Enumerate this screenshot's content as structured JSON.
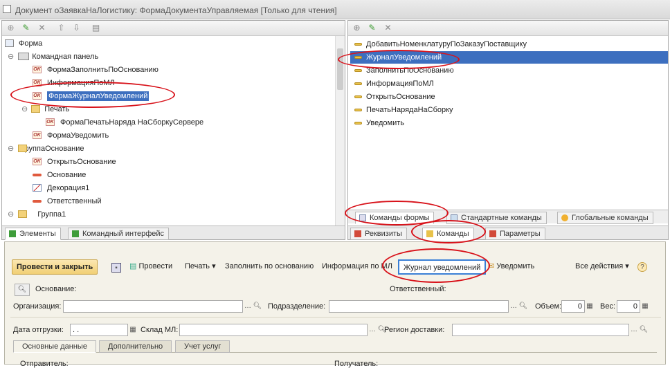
{
  "window": {
    "title": "Документ оЗаявкаНаЛогистику: ФормаДокументаУправляемая [Только для чтения]"
  },
  "left_tree": {
    "items": [
      {
        "label": "Форма"
      },
      {
        "label": "Командная панель"
      },
      {
        "label": "ФормаЗаполнитьПоОснованию"
      },
      {
        "label": "ИнформацияПоМЛ"
      },
      {
        "label": "ФормаЖурналУведомлений"
      },
      {
        "label": "Печать"
      },
      {
        "label": "ФормаПечатьНаряда НаСборкуСервере"
      },
      {
        "label": "ФормаУведомить"
      },
      {
        "label": "ГруппаОснование"
      },
      {
        "label": "ОткрытьОснование"
      },
      {
        "label": "Основание"
      },
      {
        "label": "Декорация1"
      },
      {
        "label": "Ответственный"
      },
      {
        "label": "Группа1"
      }
    ],
    "tabs": [
      "Элементы",
      "Командный интерфейс"
    ]
  },
  "right_list": {
    "items": [
      "ДобавитьНоменклатуруПоЗаказуПоставщику",
      "ЖурналУведомлений",
      "ЗаполнитьПоОснованию",
      "ИнформацияПоМЛ",
      "ОткрытьОснование",
      "ПечатьНарядаНаСборку",
      "Уведомить"
    ],
    "subtabs": [
      "Команды формы",
      "Стандартные команды",
      "Глобальные команды"
    ],
    "tabs": [
      "Реквизиты",
      "Команды",
      "Параметры"
    ]
  },
  "form": {
    "toolbar": {
      "post_close": "Провести и закрыть",
      "post": "Провести",
      "print": "Печать",
      "fill": "Заполнить по основанию",
      "info": "Информация по МЛ",
      "journal": "Журнал уведомлений",
      "notify": "Уведомить",
      "all": "Все действия",
      "help": "?"
    },
    "fields": {
      "basis": "Основание:",
      "responsible": "Ответственный:",
      "org": "Организация:",
      "dept": "Подразделение:",
      "volume": "Объем:",
      "volume_val": "0",
      "weight": "Вес:",
      "weight_val": "0",
      "ship_date": "Дата отгрузки:",
      "ship_date_val": " .  .",
      "warehouse": "Склад МЛ:",
      "region": "Регион доставки:",
      "sender": "Отправитель:",
      "receiver": "Получатель:"
    },
    "tabs": [
      "Основные данные",
      "Дополнительно",
      "Учет услуг"
    ]
  }
}
